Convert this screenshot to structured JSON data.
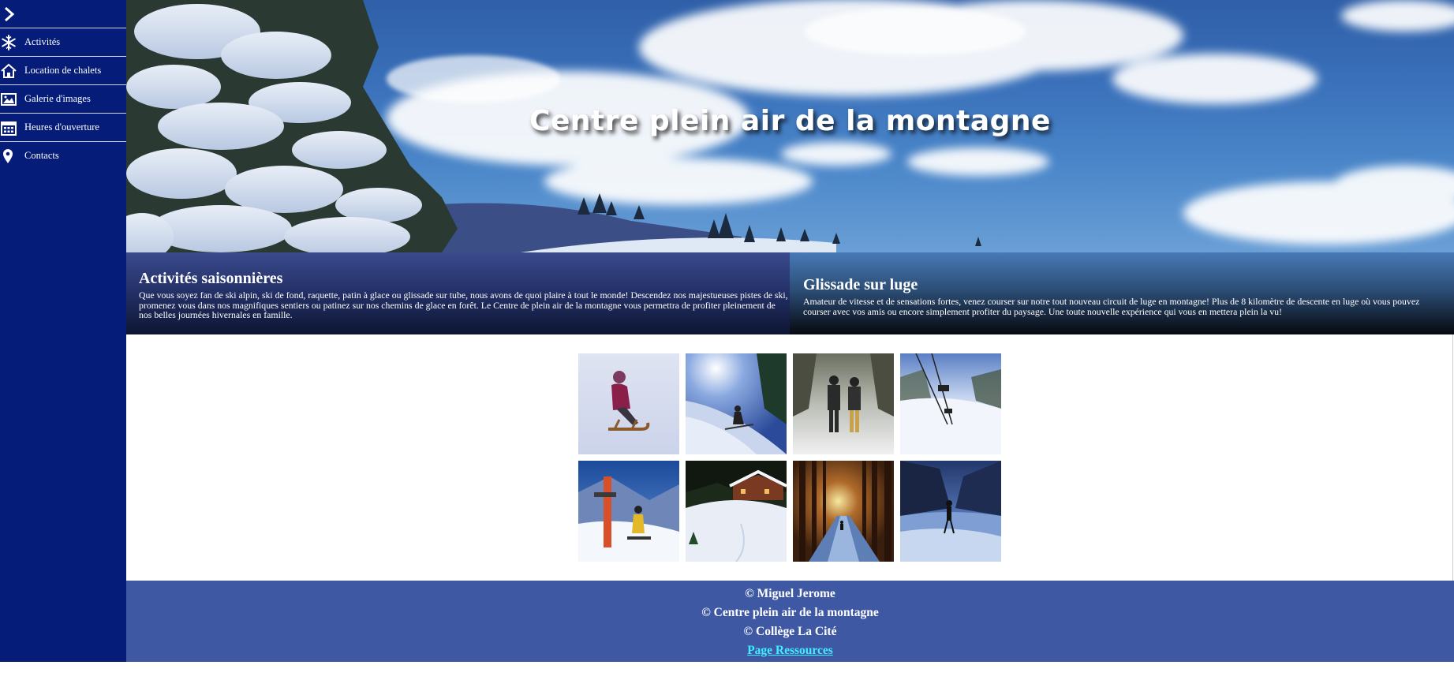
{
  "sidebar": {
    "toggle_icon": "chevron-right-icon",
    "items": [
      {
        "label": "Activités",
        "icon": "snowflake-icon"
      },
      {
        "label": "Location de chalets",
        "icon": "house-icon"
      },
      {
        "label": "Galerie d'images",
        "icon": "image-icon"
      },
      {
        "label": "Heures d'ouverture",
        "icon": "calendar-icon"
      },
      {
        "label": "Contacts",
        "icon": "map-pin-icon"
      }
    ]
  },
  "hero": {
    "title": "Centre plein air de la montagne"
  },
  "panels": [
    {
      "title": "Activités saisonnières",
      "text": "Que vous soyez fan de ski alpin, ski de fond, raquette, patin à glace ou glissade sur tube, nous avons de quoi plaire à tout le monde! Descendez nos majestueuses pistes de ski, promenez vous dans nos magnifiques sentiers ou patinez sur nos chemins de glace en forêt. Le Centre de plein air de la montagne vous permettra de profiter pleinement de nos belles journées hivernales en famille."
    },
    {
      "title": "Glissade sur luge",
      "text": "Amateur de vitesse et de sensations fortes, venez courser sur notre tout nouveau circuit de luge en montagne! Plus de 8 kilomètre de descente en luge où vous pouvez courser avec vos amis ou encore simplement profiter du paysage. Une toute nouvelle expérience qui vous en mettera plein la vu!"
    }
  ],
  "gallery": {
    "images": [
      {
        "subject": "sled-rider"
      },
      {
        "subject": "skier-slope"
      },
      {
        "subject": "hikers-snow"
      },
      {
        "subject": "chairlift"
      },
      {
        "subject": "snowboarder"
      },
      {
        "subject": "chalet"
      },
      {
        "subject": "forest-path"
      },
      {
        "subject": "ice-skater"
      }
    ]
  },
  "footer": {
    "line1": "© Miguel Jerome",
    "line2": "© Centre plein air de la montagne",
    "line3": "© Collège La Cité",
    "link": "Page Ressources"
  },
  "colors": {
    "sidebar_bg": "#051d78",
    "footer_bg": "#3f58a4",
    "link": "#3ef0ff"
  }
}
